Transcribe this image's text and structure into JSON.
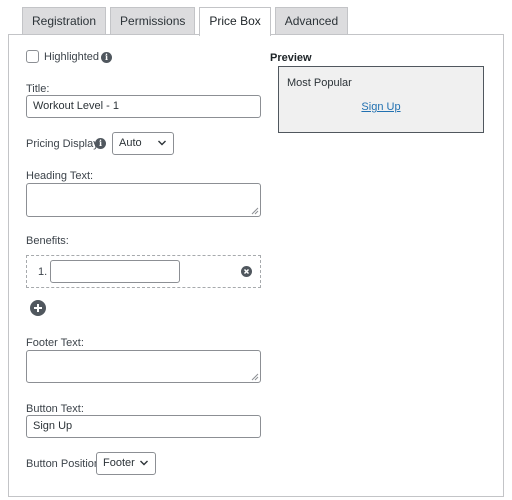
{
  "tabs": [
    {
      "label": "Registration",
      "active": false
    },
    {
      "label": "Permissions",
      "active": false
    },
    {
      "label": "Price Box",
      "active": true
    },
    {
      "label": "Advanced",
      "active": false
    }
  ],
  "form": {
    "highlighted_label": "Highlighted",
    "highlighted_checked": false,
    "title_label": "Title:",
    "title_value": "Workout Level - 1",
    "pricing_display_label": "Pricing Display",
    "pricing_display_value": "Auto",
    "heading_text_label": "Heading Text:",
    "heading_text_value": "",
    "benefits_label": "Benefits:",
    "benefits": [
      {
        "number": "1.",
        "value": ""
      }
    ],
    "footer_text_label": "Footer Text:",
    "footer_text_value": "",
    "button_text_label": "Button Text:",
    "button_text_value": "Sign Up",
    "button_position_label": "Button Position",
    "button_position_value": "Footer"
  },
  "preview": {
    "title": "Preview",
    "heading": "Most Popular",
    "button_label": "Sign Up"
  },
  "colors": {
    "link": "#2271b1",
    "tab_inactive_bg": "#dcdcde",
    "preview_bg": "#f0f0f0",
    "icon": "#50575e"
  },
  "icons": {
    "info": "info-icon",
    "remove": "remove-circle-icon",
    "add": "add-circle-icon",
    "dropdown": "chevron-down-icon"
  }
}
